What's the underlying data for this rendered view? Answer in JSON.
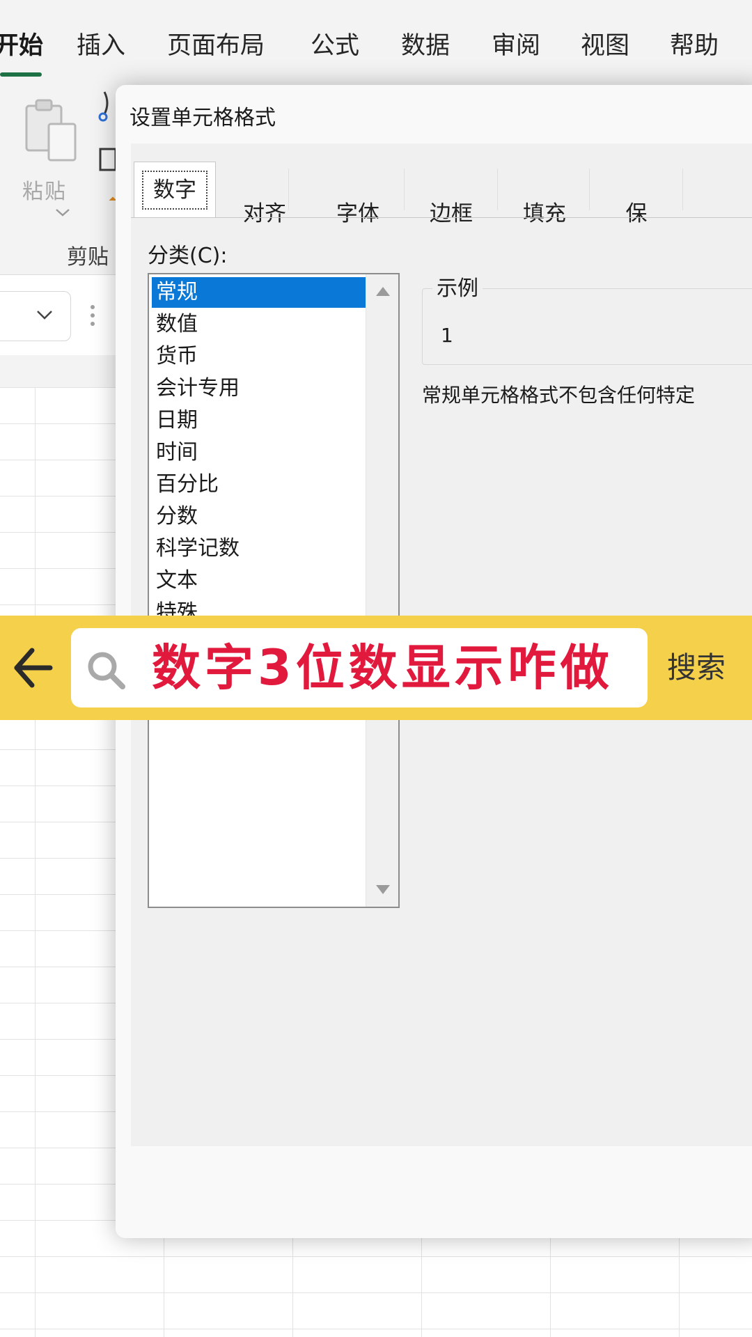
{
  "ribbon": {
    "tabs": [
      "开始",
      "插入",
      "页面布局",
      "公式",
      "数据",
      "审阅",
      "视图",
      "帮助"
    ],
    "paste_label": "粘贴",
    "clipboard_group_label": "剪贴"
  },
  "dialog": {
    "title": "设置单元格格式",
    "tabs": [
      "数字",
      "对齐",
      "字体",
      "边框",
      "填充",
      "保"
    ],
    "selected_tab": "数字",
    "category_label": "分类(C):",
    "categories": [
      "常规",
      "数值",
      "货币",
      "会计专用",
      "日期",
      "时间",
      "百分比",
      "分数",
      "科学记数",
      "文本",
      "特殊"
    ],
    "selected_category": "常规",
    "sample_label": "示例",
    "sample_value": "1",
    "description": "常规单元格格式不包含任何特定"
  },
  "search": {
    "query": "数字3位数显示咋做",
    "button_label": "搜索"
  },
  "colors": {
    "accent_green": "#1e7145",
    "selection_blue": "#0a78d7",
    "banner_yellow": "#f5d04a",
    "query_red": "#e0193d"
  }
}
